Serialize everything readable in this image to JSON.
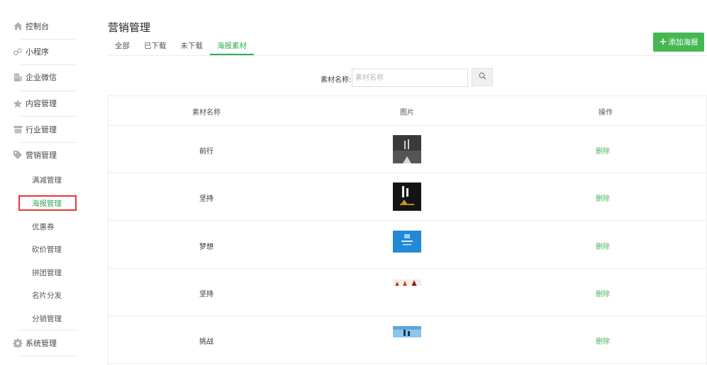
{
  "sidebar": {
    "items": [
      {
        "label": "控制台",
        "icon": "home-icon"
      },
      {
        "label": "小程序",
        "icon": "miniprogram-icon"
      },
      {
        "label": "企业微信",
        "icon": "building-icon"
      },
      {
        "label": "内容管理",
        "icon": "star-icon"
      },
      {
        "label": "行业管理",
        "icon": "store-icon"
      },
      {
        "label": "营销管理",
        "icon": "tag-icon"
      },
      {
        "label": "系统管理",
        "icon": "gear-icon"
      }
    ],
    "sub_items": [
      {
        "label": "满减管理"
      },
      {
        "label": "海报管理",
        "active": true
      },
      {
        "label": "优惠券"
      },
      {
        "label": "砍价管理"
      },
      {
        "label": "拼团管理"
      },
      {
        "label": "名片分发"
      },
      {
        "label": "分销管理"
      }
    ]
  },
  "header": {
    "title": "营销管理",
    "tabs": [
      {
        "label": "全部"
      },
      {
        "label": "已下载"
      },
      {
        "label": "未下载"
      },
      {
        "label": "海报素材",
        "active": true
      }
    ],
    "add_button": {
      "label": "添加海报",
      "icon": "plus-icon"
    }
  },
  "search": {
    "label": "素材名称:",
    "placeholder": "素材名称",
    "value": "",
    "button_icon": "search-icon"
  },
  "table": {
    "columns": [
      "素材名称",
      "图片",
      "操作"
    ],
    "rows": [
      {
        "name": "前行",
        "action": "删除",
        "image": "poster-road-dark"
      },
      {
        "name": "坚持",
        "action": "删除",
        "image": "poster-black-gold"
      },
      {
        "name": "梦想",
        "action": "删除",
        "image": "poster-blue"
      },
      {
        "name": "坚持",
        "action": "删除",
        "image": "poster-red-figures"
      },
      {
        "name": "挑战",
        "action": "删除",
        "image": "poster-sky-blue"
      }
    ]
  },
  "colors": {
    "accent": "#45b854",
    "link": "#4cb85a",
    "highlight_box": "#e53935"
  }
}
